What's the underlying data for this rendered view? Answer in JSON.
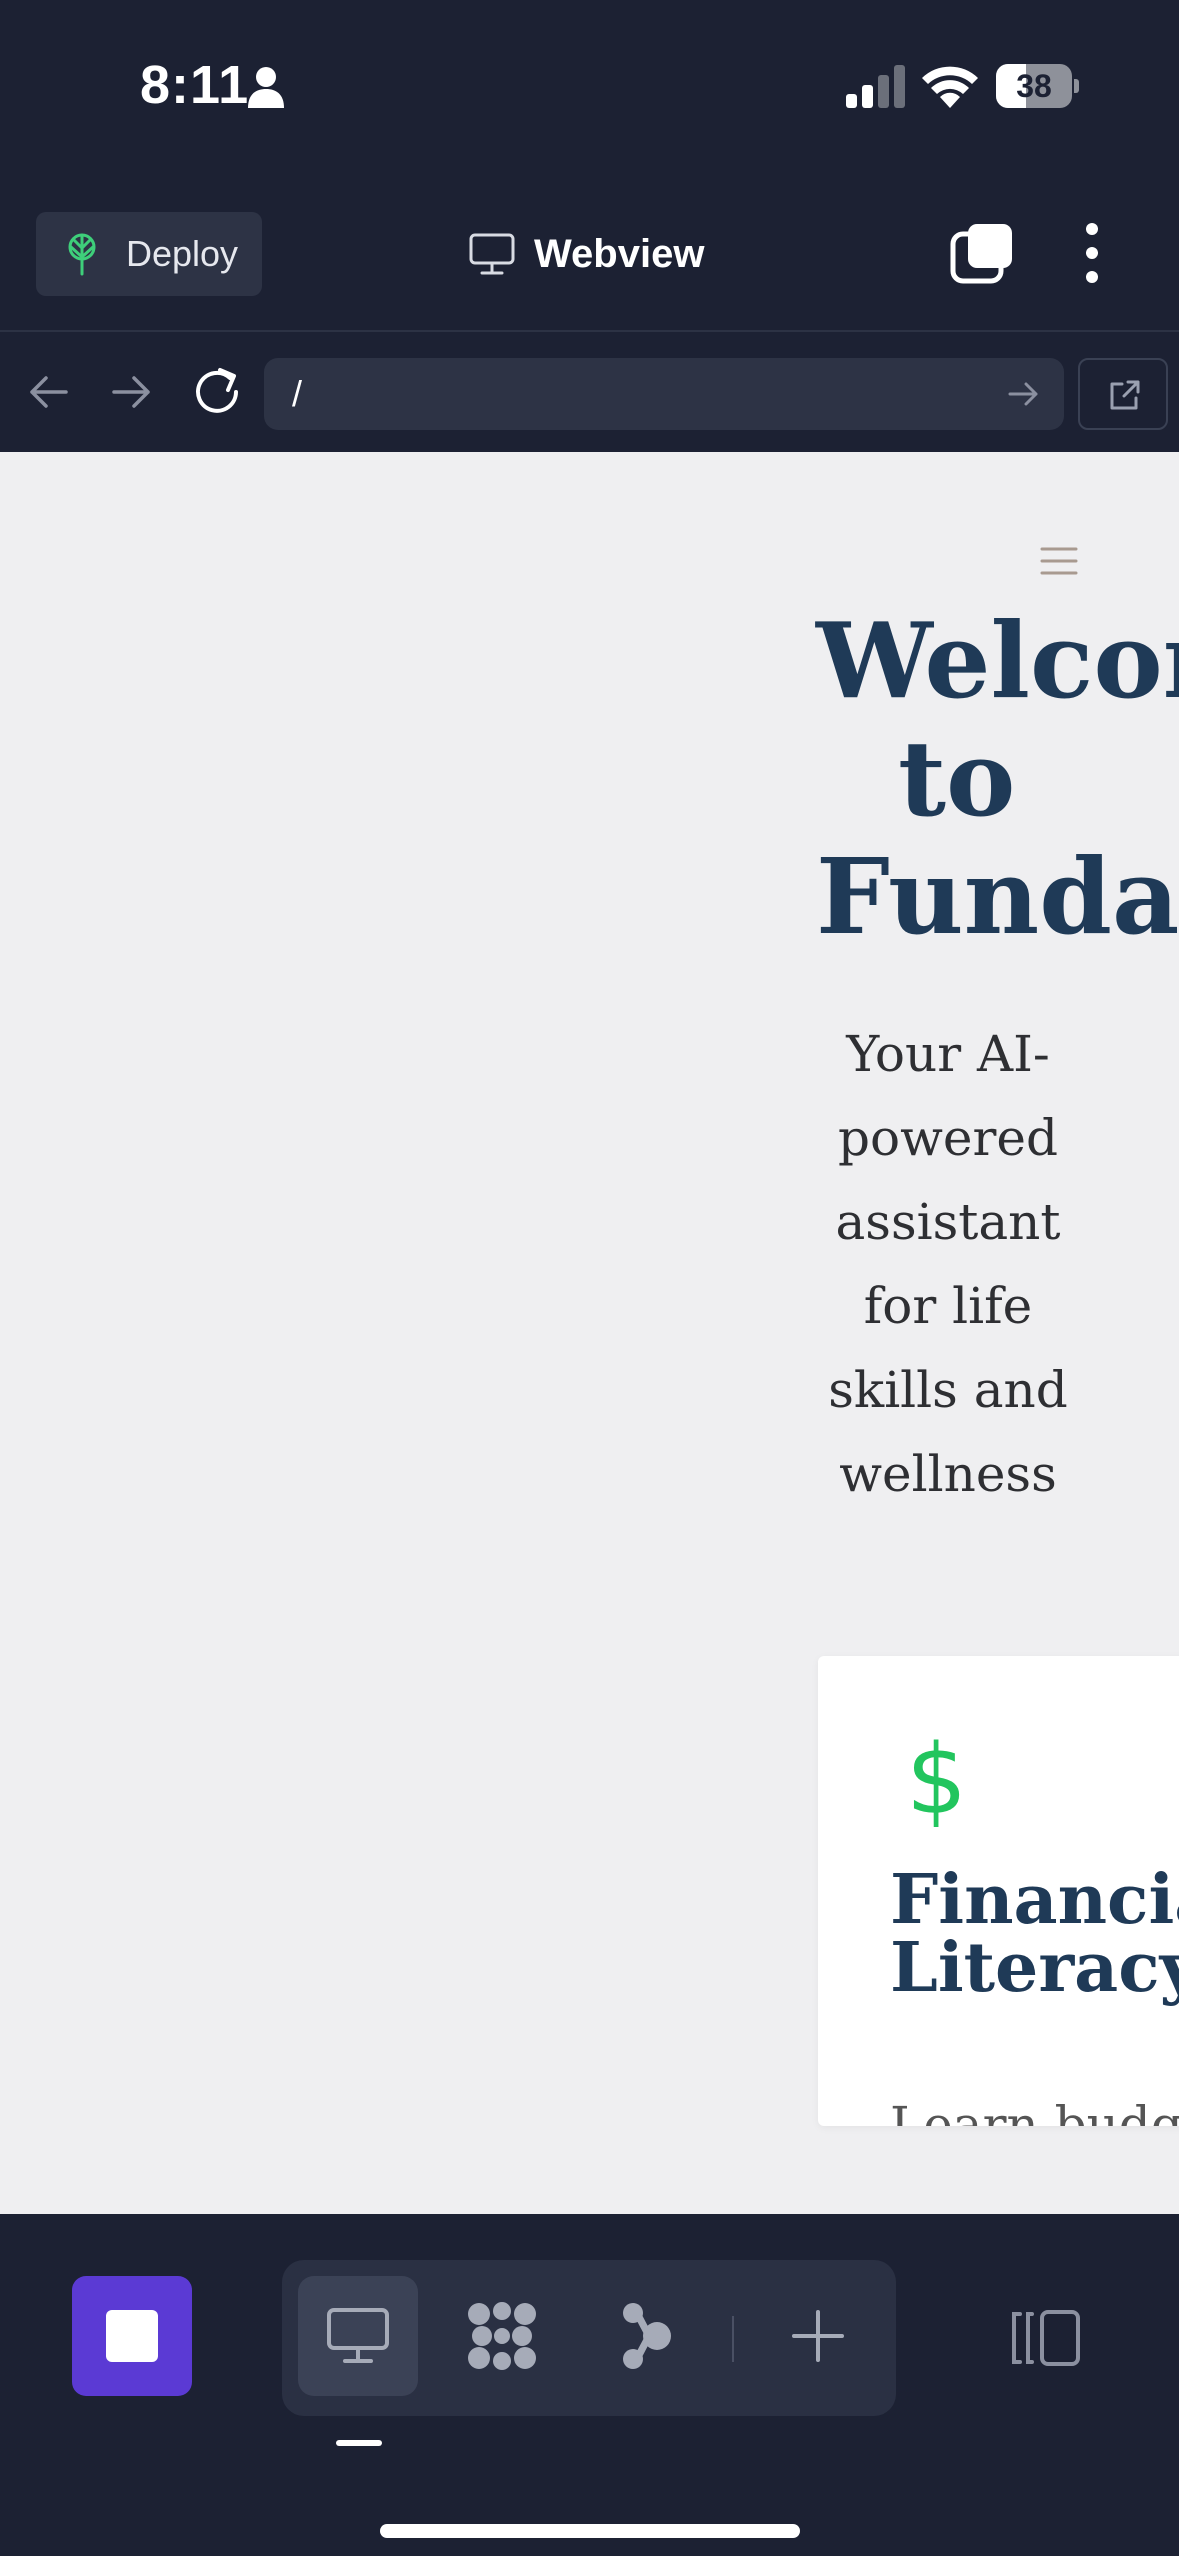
{
  "status_bar": {
    "time": "8:11",
    "battery": "38",
    "icons": [
      "person-icon",
      "cellular-signal-icon",
      "wifi-icon",
      "battery-icon"
    ]
  },
  "header": {
    "deploy_label": "Deploy",
    "title": "Webview",
    "icons": [
      "deploy-icon",
      "monitor-icon",
      "tabs-icon",
      "more-icon"
    ]
  },
  "url_bar": {
    "url": "/",
    "icons": [
      "back-arrow-icon",
      "forward-arrow-icon",
      "reload-icon",
      "go-arrow-icon",
      "open-external-icon"
    ]
  },
  "page": {
    "menu_icon": "hamburger-icon",
    "hero_title_line1": "Welcome",
    "hero_title_line2": "to",
    "hero_title_line3": "Fundamentals",
    "hero_subtitle_lines": [
      "Your AI-",
      "powered",
      "assistant",
      "for life",
      "skills and",
      "wellness"
    ],
    "card": {
      "icon": "dollar-icon",
      "icon_glyph": "$",
      "title_line1": "Financial",
      "title_line2": "Literacy",
      "description": "Learn budgeting"
    },
    "colors": {
      "heading": "#1f3a57",
      "accent_green": "#22c55e",
      "page_bg": "#efeff1"
    }
  },
  "toolbar": {
    "icons": [
      "stop-icon",
      "desktop-view-icon",
      "grid-dots-icon",
      "branch-icon",
      "add-icon",
      "side-panel-icon"
    ],
    "colors": {
      "stop_button": "#5b3ad4",
      "bar_bg": "#1c2133"
    }
  }
}
